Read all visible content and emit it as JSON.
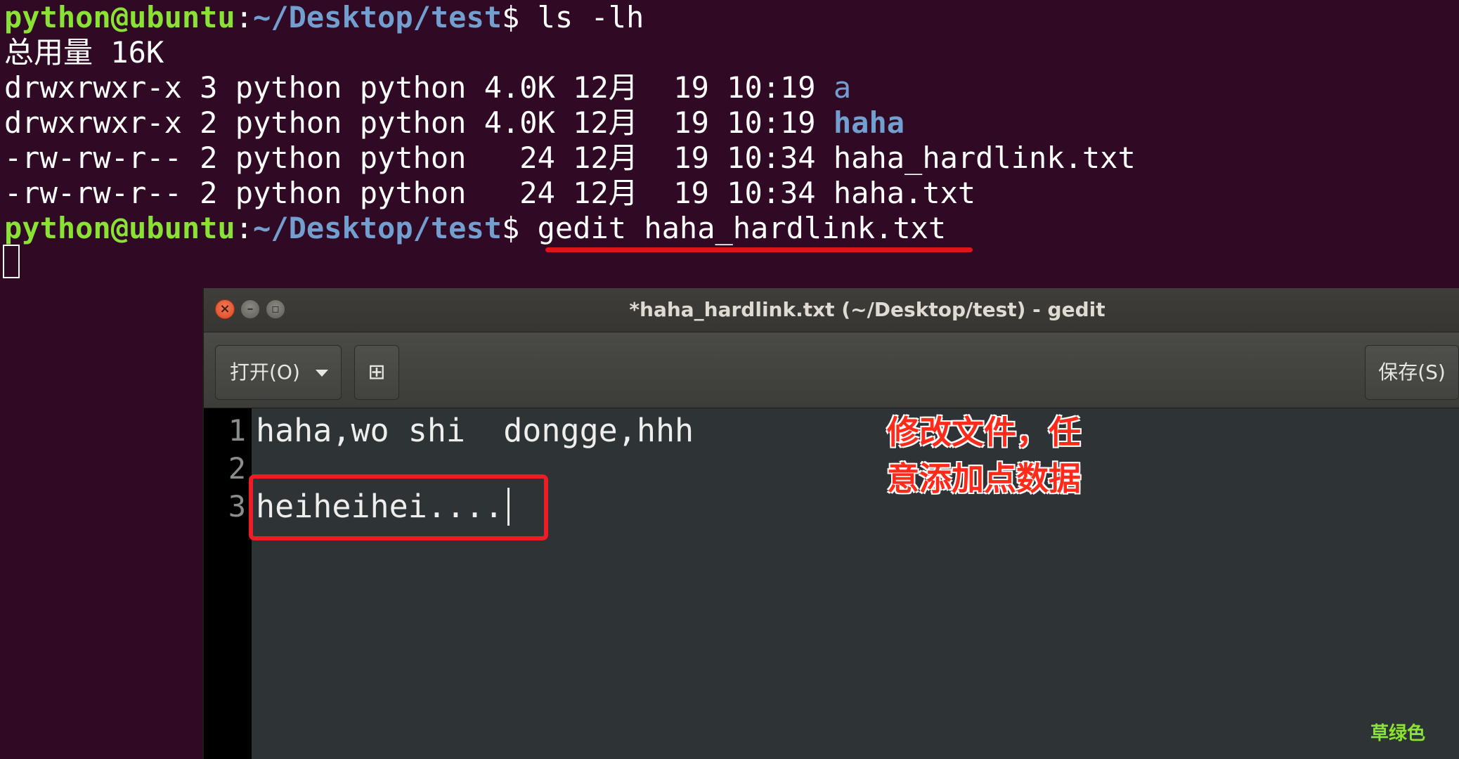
{
  "terminal": {
    "prompt_user": "python@ubuntu",
    "prompt_sep": ":",
    "prompt_path": "~/Desktop/test",
    "prompt_dollar": "$ ",
    "cmd1": "ls -lh",
    "total": "总用量 16K",
    "rows": [
      {
        "meta": "drwxrwxr-x 3 python python 4.0K 12月  19 10:19 ",
        "name": "a"
      },
      {
        "meta": "drwxrwxr-x 2 python python 4.0K 12月  19 10:19 ",
        "name": "haha"
      },
      {
        "meta": "-rw-rw-r-- 2 python python   24 12月  19 10:34 ",
        "name": "haha_hardlink.txt"
      },
      {
        "meta": "-rw-rw-r-- 2 python python   24 12月  19 10:34 ",
        "name": "haha.txt"
      }
    ],
    "cmd2": "gedit haha_hardlink.txt"
  },
  "gedit": {
    "title": "*haha_hardlink.txt (~/Desktop/test) - gedit",
    "open_label": "打开(O)",
    "save_label": "保存(S)",
    "new_doc_glyph": "⊞",
    "lines": [
      {
        "num": "1",
        "text": "haha,wo shi  dongge,hhh"
      },
      {
        "num": "2",
        "text": ""
      },
      {
        "num": "3",
        "text": "heiheihei...."
      }
    ]
  },
  "annotation": {
    "line1": "修改文件，任",
    "line2": "意添加点数据",
    "color": "#ff2a1a"
  },
  "watermark": "草绿色"
}
